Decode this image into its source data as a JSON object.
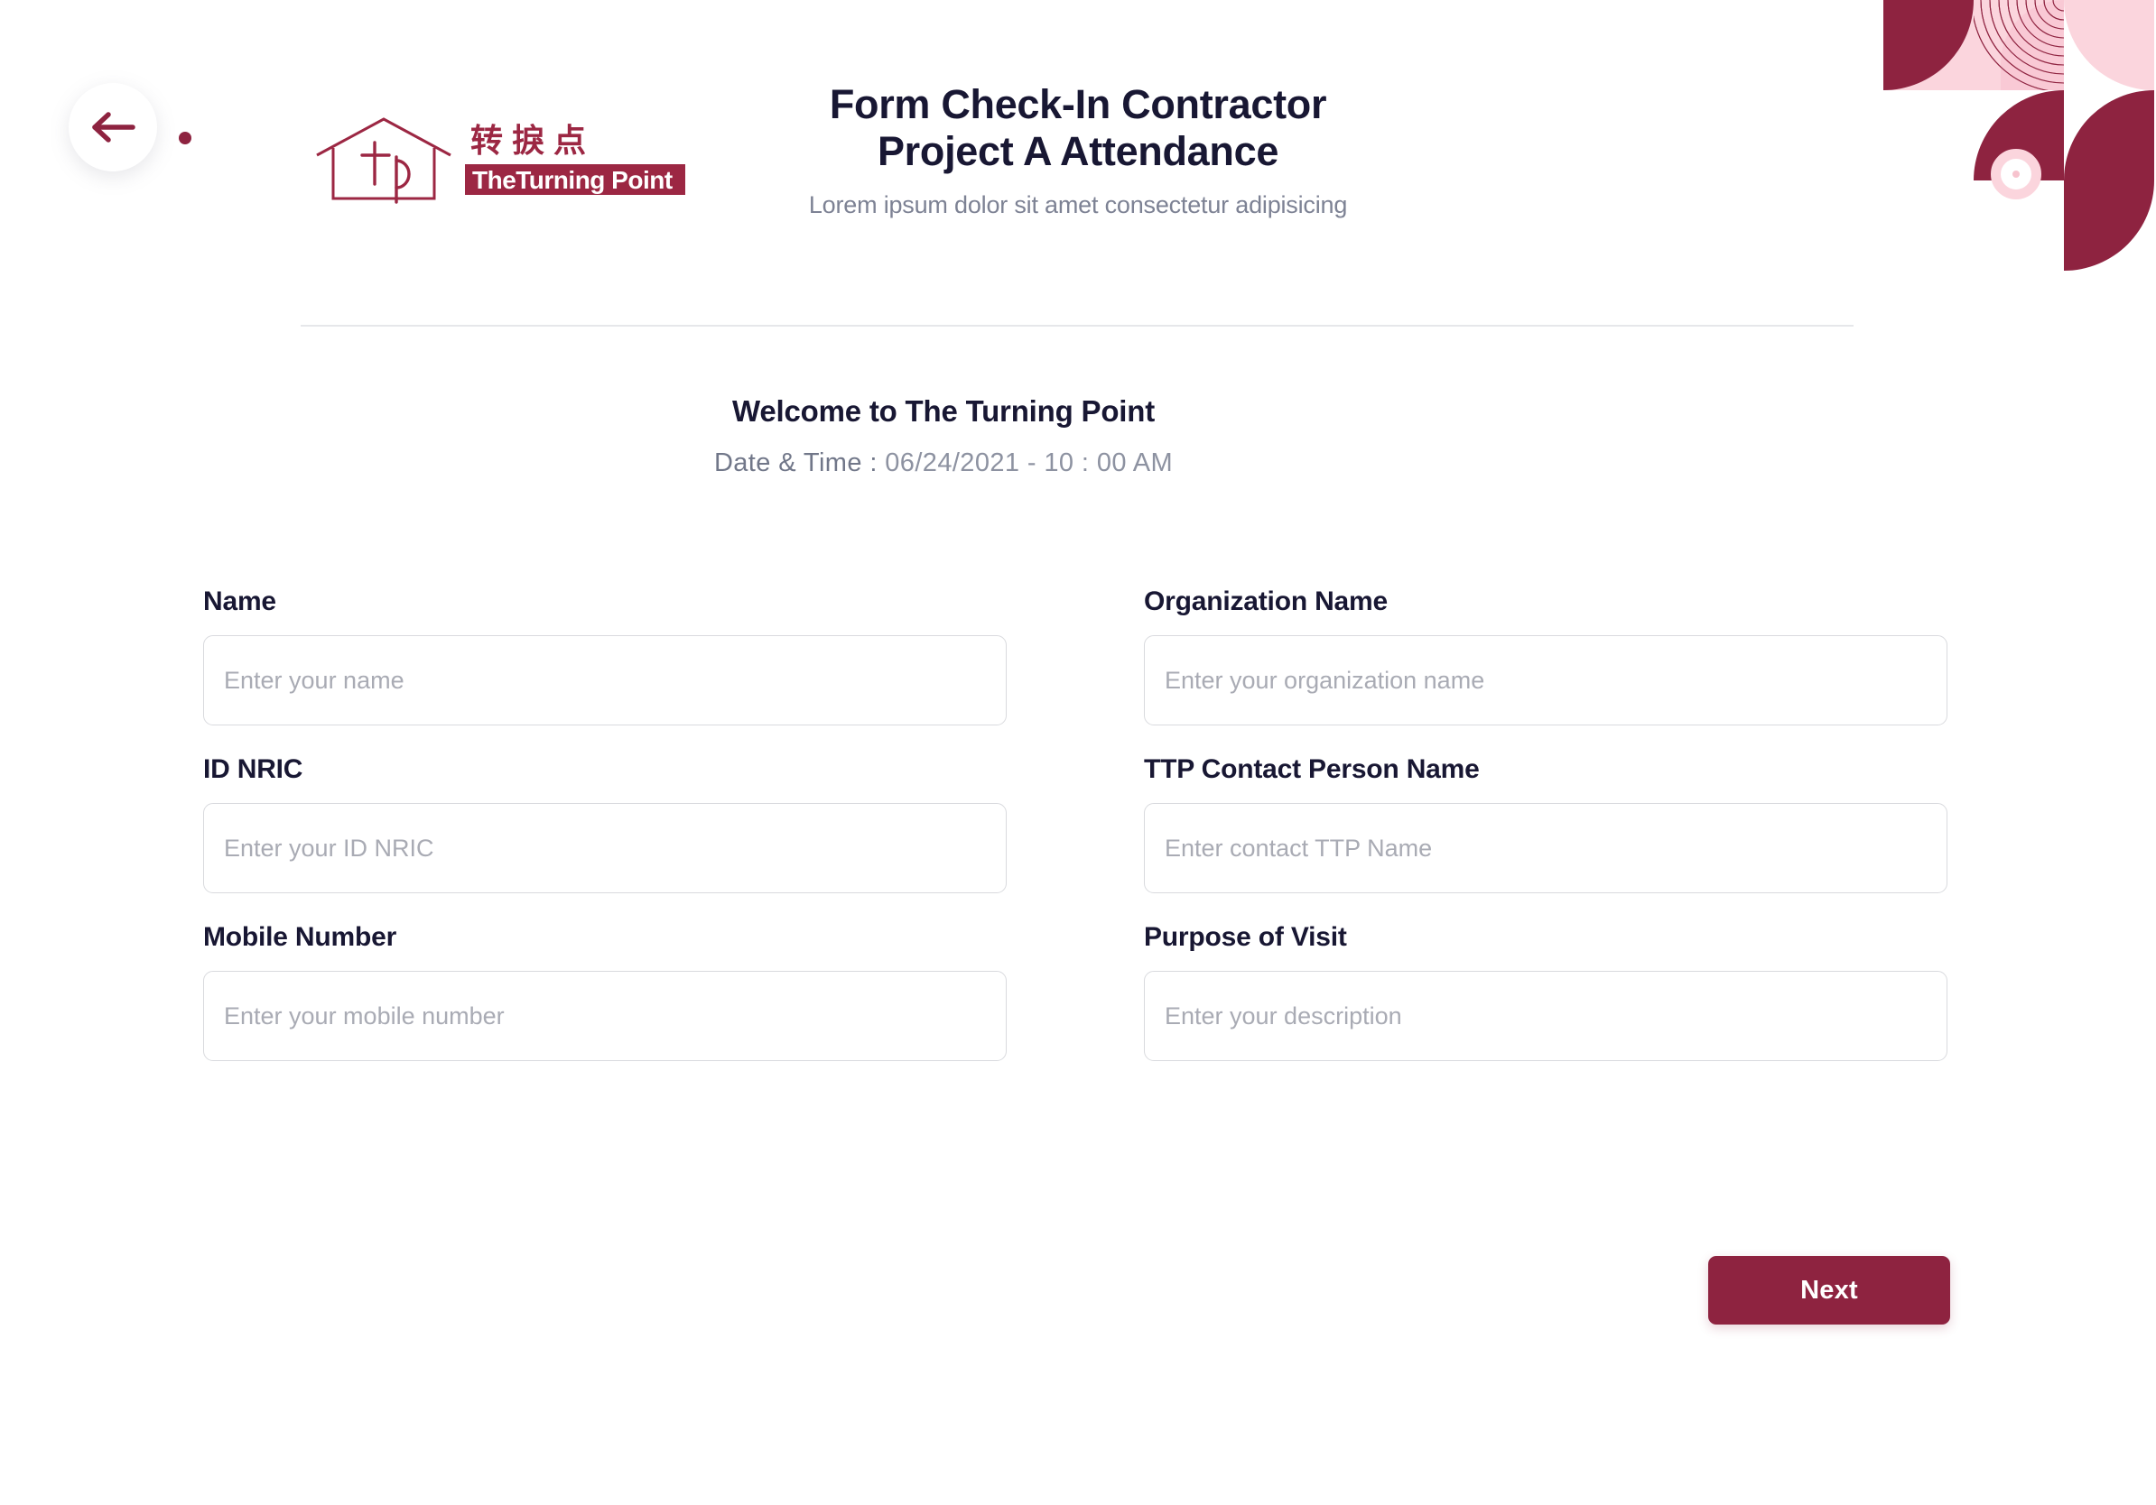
{
  "brand": {
    "accent_color": "#8e2340",
    "accent_light": "#fbd5dd",
    "logo_chinese": "转捩点",
    "logo_wordmark": "TheTurning Point",
    "logo_monogram": "tp"
  },
  "nav": {
    "back_label": "Back"
  },
  "header": {
    "title_line1": "Form Check-In Contractor",
    "title_line2": "Project A Attendance",
    "subtitle": "Lorem ipsum dolor sit amet consectetur adipisicing"
  },
  "welcome": {
    "title": "Welcome to The Turning Point",
    "datetime_label": "Date & Time :",
    "datetime_value": "06/24/2021  -  10 : 00 AM"
  },
  "form": {
    "fields": [
      {
        "label": "Name",
        "placeholder": "Enter your name",
        "value": ""
      },
      {
        "label": "Organization Name",
        "placeholder": "Enter your organization name",
        "value": ""
      },
      {
        "label": "ID NRIC",
        "placeholder": "Enter your ID NRIC",
        "value": ""
      },
      {
        "label": "TTP Contact Person Name",
        "placeholder": "Enter contact TTP Name",
        "value": ""
      },
      {
        "label": "Mobile Number",
        "placeholder": "Enter your mobile number",
        "value": ""
      },
      {
        "label": "Purpose of Visit",
        "placeholder": "Enter your description",
        "value": ""
      }
    ]
  },
  "actions": {
    "next_label": "Next"
  }
}
